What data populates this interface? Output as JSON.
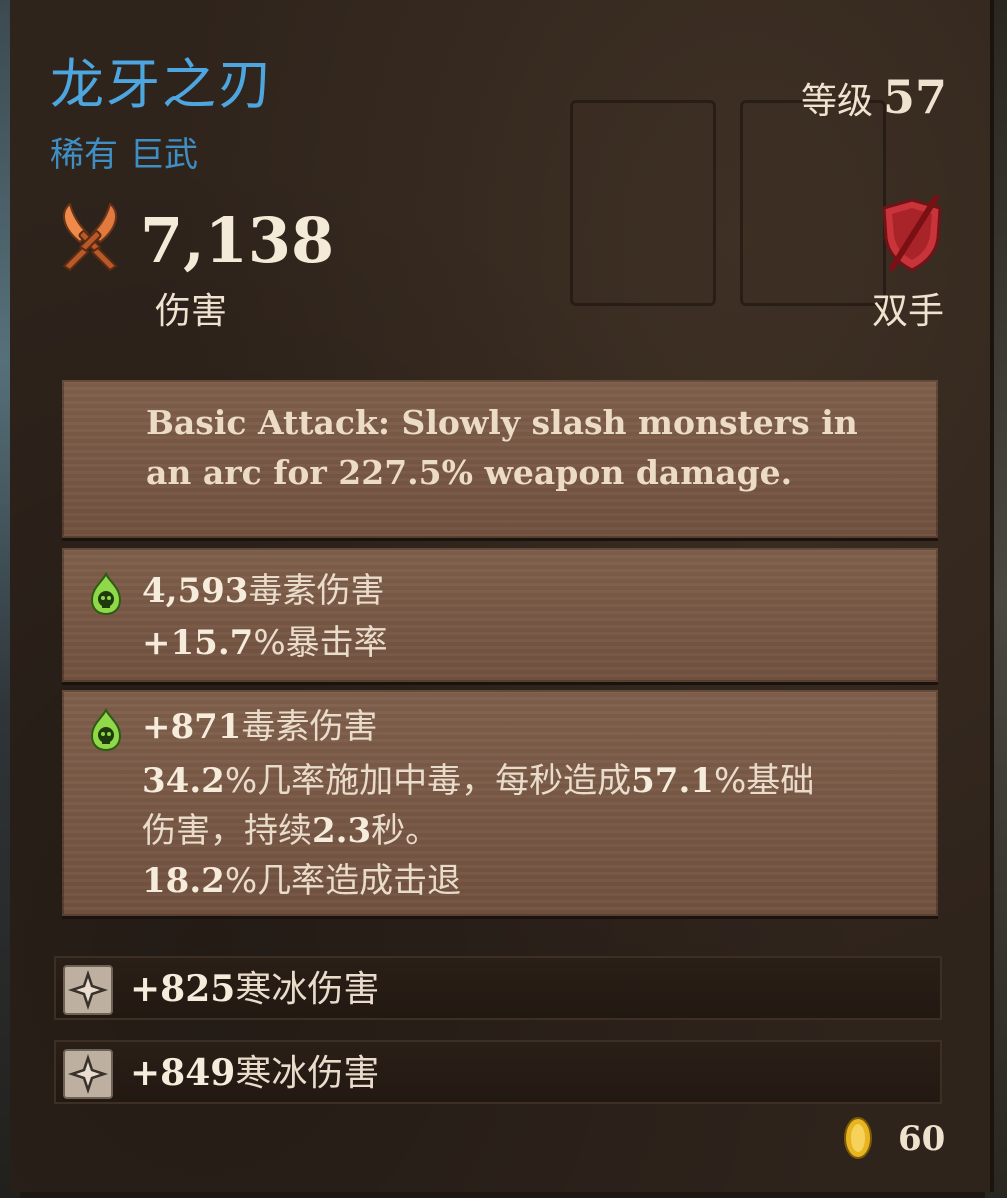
{
  "item": {
    "name": "龙牙之刃",
    "rarity": "稀有",
    "type": "巨武",
    "level_label": "等级",
    "level": "57"
  },
  "stats": {
    "damage_value": "7,138",
    "damage_label": "伤害",
    "hand_label": "双手",
    "damage_icon": "crossed-swords-icon",
    "hand_icon": "red-shield-icon"
  },
  "description": "Basic Attack: Slowly slash monsters in an arc for 227.5% weapon damage.",
  "affixes": [
    {
      "icon": "poison-skull-icon",
      "lines": [
        {
          "value": "4,593",
          "text": "毒素伤害"
        },
        {
          "prefix": "+",
          "value": "15.7",
          "text": "%暴击率"
        }
      ]
    },
    {
      "icon": "poison-skull-icon",
      "lines": [
        {
          "value": "+871",
          "text": "毒素伤害"
        },
        {
          "value": "34.2",
          "text": "%几率施加中毒，每秒造成",
          "value2": "57.1",
          "text2": "%基础"
        },
        {
          "text": "伤害，持续",
          "value": "2.3",
          "text2": "秒。"
        },
        {
          "value": "18.2",
          "text": "%几率造成击退"
        }
      ]
    }
  ],
  "gems": [
    {
      "icon": "frost-gem-icon",
      "value": "+825",
      "text": "寒冰伤害"
    },
    {
      "icon": "frost-gem-icon",
      "value": "+849",
      "text": "寒冰伤害"
    }
  ],
  "price": {
    "icon": "gold-coin-icon",
    "value": "60"
  },
  "colors": {
    "rarity_blue": "#4ea6e0",
    "plank": "#7a5846",
    "panel": "#2f241c",
    "poison_green": "#8ed84a",
    "shield_red": "#c9343a",
    "gold": "#e8b422"
  }
}
